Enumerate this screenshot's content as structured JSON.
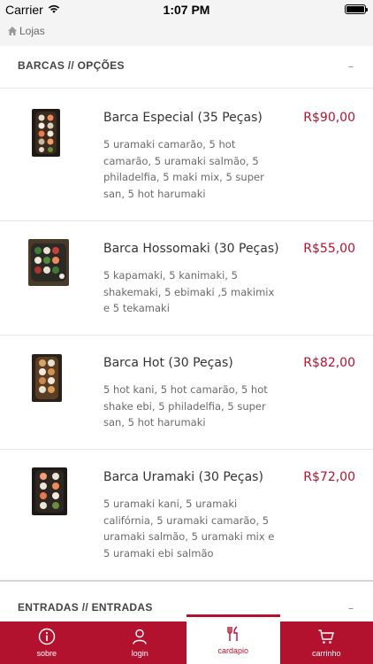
{
  "status_bar": {
    "carrier": "Carrier",
    "time": "1:07 PM"
  },
  "nav": {
    "back_label": "Lojas"
  },
  "sections": [
    {
      "title": "BARCAS // OPÇÕES",
      "collapse_label": "–",
      "items": [
        {
          "name": "Barca Especial (35 Peças)",
          "price": "R$90,00",
          "description": "5 uramaki camarão, 5 hot camarão, 5 uramaki salmão, 5 philadelfia, 5 maki mix, 5 super san, 5 hot harumaki"
        },
        {
          "name": "Barca Hossomaki (30 Peças)",
          "price": "R$55,00",
          "description": "5 kapamaki, 5 kanimaki, 5 shakemaki, 5 ebimaki ,5 makimix e 5 tekamaki"
        },
        {
          "name": "Barca Hot (30 Peças)",
          "price": "R$82,00",
          "description": "5 hot kani, 5 hot camarão, 5 hot shake ebi, 5 philadelfia, 5 super san, 5 hot harumaki"
        },
        {
          "name": "Barca Uramaki (30 Peças)",
          "price": "R$72,00",
          "description": "5 uramaki kani, 5 uramaki califórnia, 5 uramaki camarão, 5 uramaki salmão, 5 uramaki mix e 5 uramaki ebi salmão"
        }
      ]
    },
    {
      "title": "ENTRADAS // ENTRADAS",
      "collapse_label": "–"
    }
  ],
  "tab_bar": {
    "tabs": [
      {
        "label": "sobre",
        "icon": "info-icon"
      },
      {
        "label": "login",
        "icon": "user-icon"
      },
      {
        "label": "cardapio",
        "icon": "cutlery-icon",
        "active": true
      },
      {
        "label": "carrinho",
        "icon": "cart-icon"
      }
    ]
  },
  "colors": {
    "accent": "#b3122f",
    "background": "#ffffff",
    "bar_bg": "#f4f4f4"
  }
}
